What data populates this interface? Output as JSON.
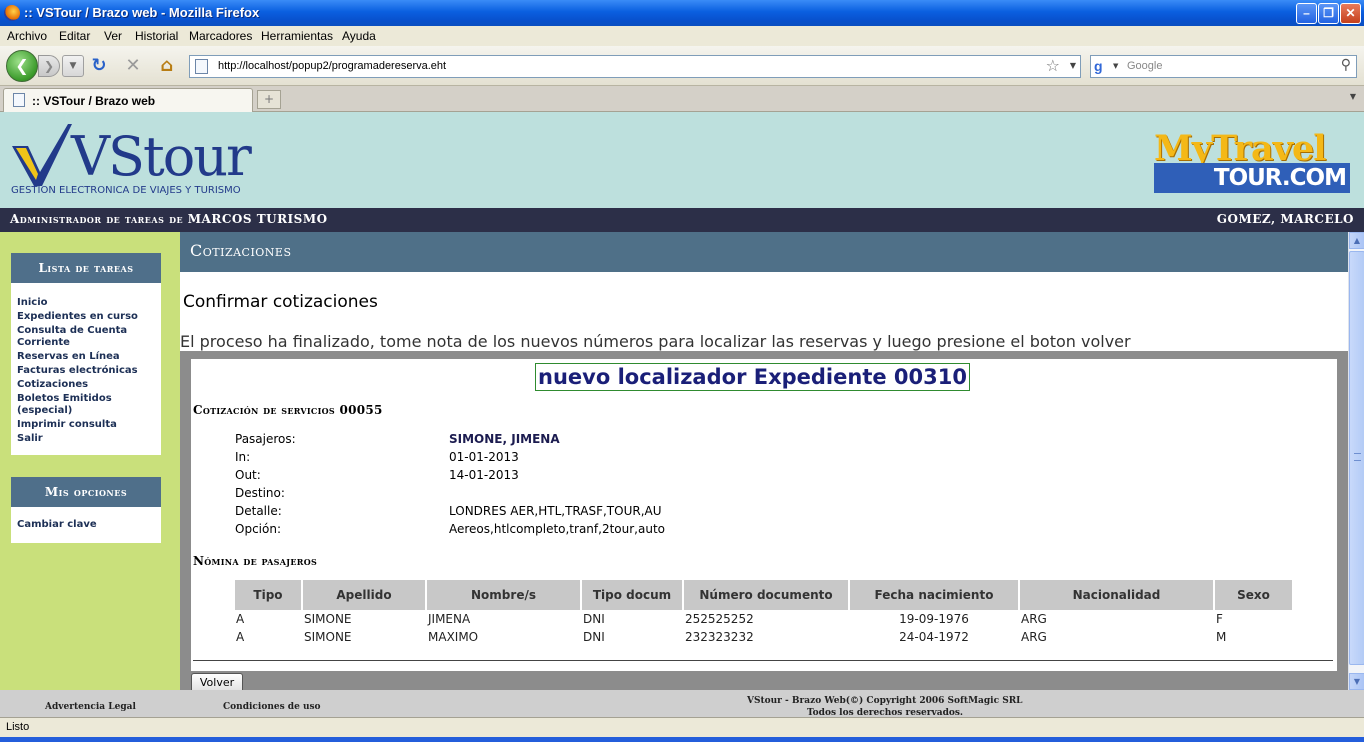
{
  "window": {
    "title": ":: VSTour / Brazo web - Mozilla Firefox",
    "minimize": "–",
    "maximize": "❐",
    "close": "✕"
  },
  "menu": [
    "Archivo",
    "Editar",
    "Ver",
    "Historial",
    "Marcadores",
    "Herramientas",
    "Ayuda"
  ],
  "nav": {
    "url": "http://localhost/popup2/programadereserva.eht",
    "search_placeholder": "Google"
  },
  "tab": {
    "label": ":: VSTour / Brazo web",
    "new_tab": "+"
  },
  "header": {
    "logo_text": "VStour",
    "logo_sub": "GESTION ELECTRONICA DE VIAJES Y TURISMO",
    "mt_top": "MyTravel",
    "mt_bottom": "TOUR.COM"
  },
  "admin_bar": {
    "left": "Administrador de tareas de MARCOS TURISMO",
    "right": "GOMEZ, MARCELO"
  },
  "sidebar": {
    "tasks_title": "Lista de tareas",
    "tasks": [
      "Inicio",
      "Expedientes en curso",
      "Consulta de Cuenta Corriente",
      "Reservas en Línea",
      "Facturas electrónicas",
      "Cotizaciones",
      "Boletos Emitidos (especial)",
      "Imprimir consulta",
      "Salir"
    ],
    "options_title": "Mis opciones",
    "options": [
      "Cambiar clave"
    ]
  },
  "main": {
    "section_title": "Cotizaciones",
    "subtitle": "Confirmar cotizaciones",
    "message": "El proceso ha finalizado, tome nota de los nuevos números para localizar las reservas y luego presione el boton volver",
    "localizador": "nuevo localizador Expediente 00310",
    "cotizacion_title": "Cotización de servicios 00055",
    "details": [
      {
        "label": "Pasajeros:",
        "value": "SIMONE, JIMENA",
        "bold": true
      },
      {
        "label": "In:",
        "value": "01-01-2013",
        "bold": false
      },
      {
        "label": "Out:",
        "value": "14-01-2013",
        "bold": false
      },
      {
        "label": "Destino:",
        "value": "",
        "bold": false
      },
      {
        "label": "Detalle:",
        "value": "LONDRES AER,HTL,TRASF,TOUR,AU",
        "bold": false
      },
      {
        "label": "Opción:",
        "value": "Aereos,htlcompleto,tranf,2tour,auto",
        "bold": false
      }
    ],
    "nomina_title": "Nómina de pasajeros",
    "table": {
      "headers": [
        "Tipo",
        "Apellido",
        "Nombre/s",
        "Tipo docum",
        "Número documento",
        "Fecha nacimiento",
        "Nacionalidad",
        "Sexo"
      ],
      "rows": [
        [
          "A",
          "SIMONE",
          "JIMENA",
          "DNI",
          "252525252",
          "19-09-1976",
          "ARG",
          "F"
        ],
        [
          "A",
          "SIMONE",
          "MAXIMO",
          "DNI",
          "232323232",
          "24-04-1972",
          "ARG",
          "M"
        ]
      ]
    },
    "volver_label": "Volver"
  },
  "footer": {
    "legal": "Advertencia Legal",
    "conditions": "Condiciones de uso",
    "copyright": "VStour - Brazo Web(©) Copyright 2006 SoftMagic SRL",
    "rights": "Todos los derechos reservados."
  },
  "status": {
    "text": "Listo"
  }
}
